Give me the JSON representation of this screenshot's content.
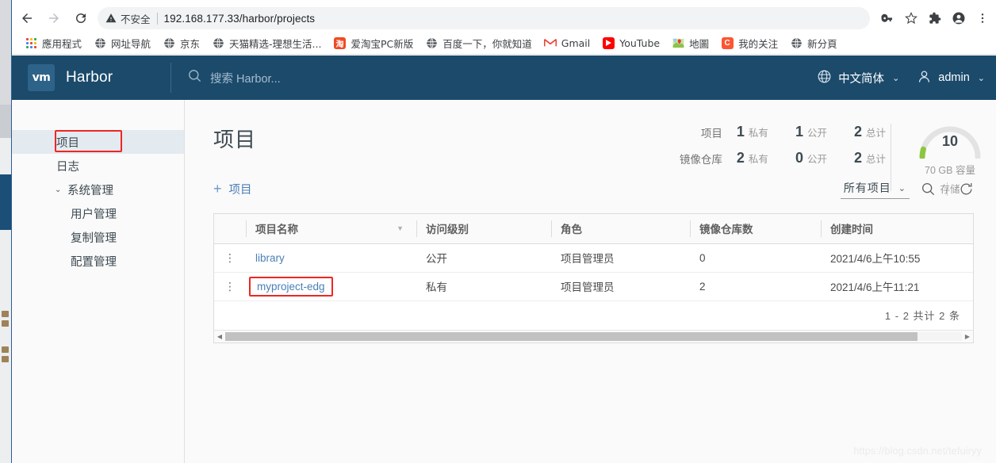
{
  "browser": {
    "nav": {
      "back_label": "Back",
      "forward_label": "Forward",
      "reload_label": "Reload"
    },
    "omnibox": {
      "security_label": "不安全",
      "url": "192.168.177.33/harbor/projects",
      "icons": [
        "key-icon",
        "star-icon",
        "extensions-icon",
        "profile-icon",
        "menu-icon"
      ]
    },
    "bookmarks": [
      {
        "label": "應用程式",
        "icon": "apps-grid-icon"
      },
      {
        "label": "网址导航",
        "icon": "globe-icon"
      },
      {
        "label": "京东",
        "icon": "globe-icon"
      },
      {
        "label": "天猫精选-理想生活...",
        "icon": "globe-icon"
      },
      {
        "label": "爱淘宝PC新版",
        "icon": "taobao-icon"
      },
      {
        "label": "百度一下，你就知道",
        "icon": "globe-icon"
      },
      {
        "label": "Gmail",
        "icon": "gmail-icon"
      },
      {
        "label": "YouTube",
        "icon": "youtube-icon"
      },
      {
        "label": "地圖",
        "icon": "maps-icon"
      },
      {
        "label": "我的关注",
        "icon": "csdn-icon"
      },
      {
        "label": "新分頁",
        "icon": "globe-icon"
      }
    ]
  },
  "harbor": {
    "header": {
      "logo_text": "vm",
      "brand": "Harbor",
      "search_placeholder": "搜索 Harbor...",
      "language": "中文简体",
      "user": "admin"
    },
    "sidebar": [
      {
        "label": "项目",
        "level": 0,
        "active": true,
        "highlighted": true
      },
      {
        "label": "日志",
        "level": 0,
        "active": false,
        "highlighted": false
      },
      {
        "label": "系统管理",
        "level": 0,
        "active": false,
        "group": true,
        "highlighted": false
      },
      {
        "label": "用户管理",
        "level": 1,
        "active": false,
        "highlighted": false
      },
      {
        "label": "复制管理",
        "level": 1,
        "active": false,
        "highlighted": false
      },
      {
        "label": "配置管理",
        "level": 1,
        "active": false,
        "highlighted": false
      }
    ],
    "page_title": "项目",
    "stats": {
      "rows": [
        {
          "label": "项目",
          "private_count": "1",
          "private_unit": "私有",
          "public_count": "1",
          "public_unit": "公开",
          "total_count": "2",
          "total_unit": "总计"
        },
        {
          "label": "镜像仓库",
          "private_count": "2",
          "private_unit": "私有",
          "public_count": "0",
          "public_unit": "公开",
          "total_count": "2",
          "total_unit": "总计"
        }
      ],
      "gauge": {
        "value": "10",
        "capacity": "70 GB 容量",
        "sublabel": "存储",
        "percent": 10,
        "arc_color": "#8cc63f",
        "track_color": "#e3e3e3"
      }
    },
    "toolbar": {
      "new_project_label": "项目",
      "plus_glyph": "+",
      "filter_label": "所有项目",
      "search_icon": "search-icon",
      "refresh_icon": "refresh-icon"
    },
    "table": {
      "columns": [
        "项目名称",
        "访问级别",
        "角色",
        "镜像仓库数",
        "创建时间"
      ],
      "rows": [
        {
          "name": "library",
          "access": "公开",
          "role": "项目管理员",
          "repos": "0",
          "created": "2021/4/6上午10:55",
          "highlighted": false
        },
        {
          "name": "myproject-edg",
          "access": "私有",
          "role": "项目管理员",
          "repos": "2",
          "created": "2021/4/6上午11:21",
          "highlighted": true
        }
      ],
      "pagination": "1 - 2 共计 2 条"
    },
    "watermark": "https://blog.csdn.net/tefuiryy"
  },
  "colors": {
    "header_bg": "#1b4a6b",
    "link": "#4a7fb5",
    "highlight": "#ee2722",
    "chrome_tab": "#2b5f93"
  }
}
